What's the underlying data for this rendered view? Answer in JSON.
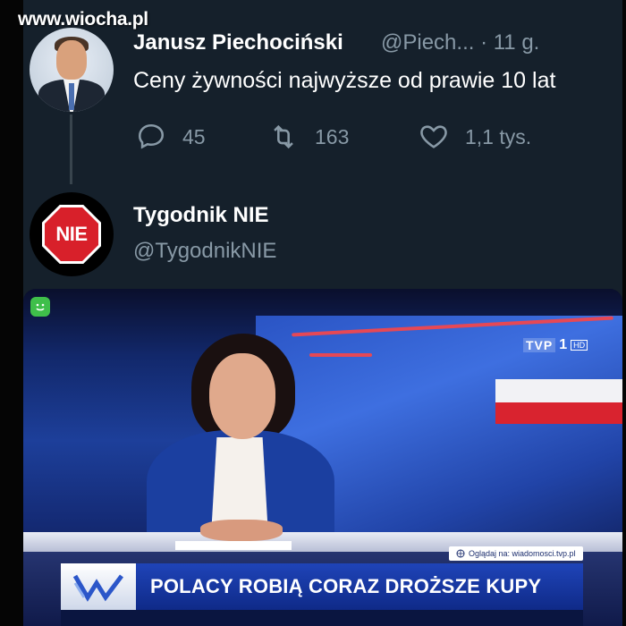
{
  "watermark": "www.wiocha.pl",
  "tweet1": {
    "name": "Janusz Piechociński",
    "handle": "@Piech... · 11 g.",
    "text": "Ceny żywności najwyższe od prawie 10 lat",
    "reply_count": "45",
    "retweet_count": "163",
    "like_count": "1,1 tys."
  },
  "tweet2": {
    "name": "Tygodnik NIE",
    "handle": "@TygodnikNIE",
    "avatar_text": "NIE"
  },
  "media": {
    "channel_logo": "TVP",
    "channel_number": "1",
    "channel_hd": "HD",
    "watch_banner": "Oglądaj na: wiadomosci.tvp.pl",
    "headline": "POLACY ROBIĄ CORAZ DROŻSZE KUPY"
  },
  "colors": {
    "background": "#15202b",
    "secondary_text": "#8899a6",
    "primary_text": "#ffffff",
    "stop_sign_red": "#d8202a",
    "ticker_blue": "#1f44b8"
  },
  "icons": {
    "reply": "reply-icon",
    "retweet": "retweet-icon",
    "like": "heart-icon"
  }
}
